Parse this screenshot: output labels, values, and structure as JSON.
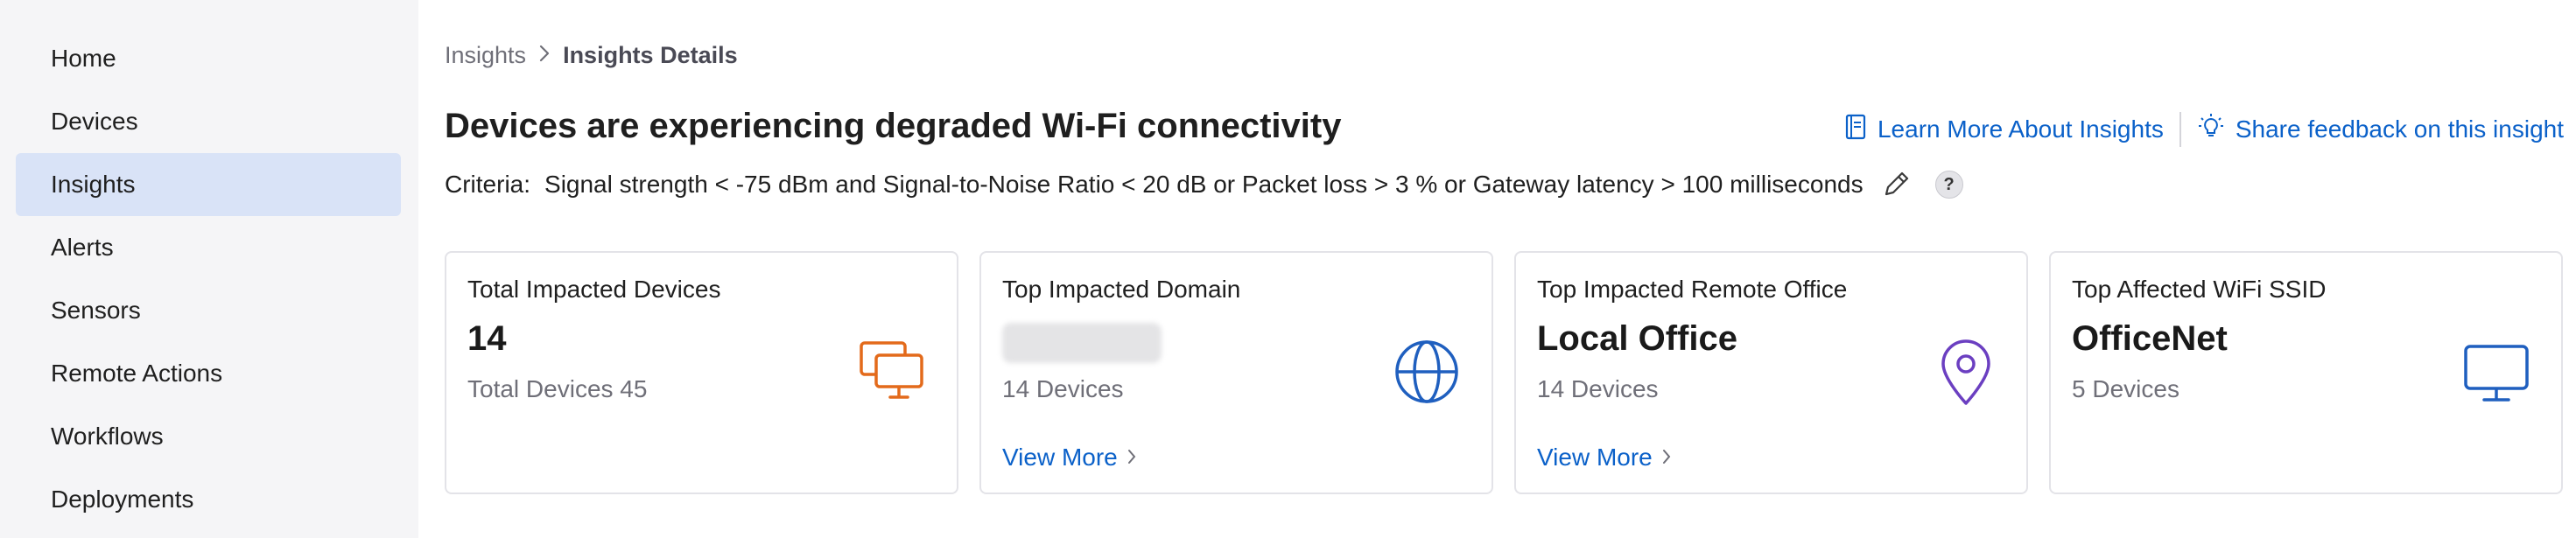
{
  "sidebar": {
    "items": [
      {
        "label": "Home"
      },
      {
        "label": "Devices"
      },
      {
        "label": "Insights",
        "active": true
      },
      {
        "label": "Alerts"
      },
      {
        "label": "Sensors"
      },
      {
        "label": "Remote Actions"
      },
      {
        "label": "Workflows"
      },
      {
        "label": "Deployments"
      }
    ]
  },
  "breadcrumb": {
    "parent": "Insights",
    "separator": ">",
    "current": "Insights Details"
  },
  "page": {
    "title": "Devices are experiencing degraded Wi-Fi connectivity"
  },
  "header_links": {
    "learn_more": "Learn More About Insights",
    "feedback": "Share feedback on this insight"
  },
  "criteria": {
    "label": "Criteria:",
    "text": "Signal strength < -75 dBm and Signal-to-Noise Ratio < 20 dB or Packet loss > 3 % or Gateway latency > 100 milliseconds",
    "help": "?"
  },
  "cards": {
    "total": {
      "title": "Total Impacted Devices",
      "value": "14",
      "sub": "Total Devices 45",
      "icon": "devices-icon",
      "color": "#e36a1b"
    },
    "domain": {
      "title": "Top Impacted Domain",
      "sub": "14 Devices",
      "link": "View More",
      "icon": "globe-icon",
      "color": "#1f5fbf"
    },
    "office": {
      "title": "Top Impacted Remote Office",
      "value": "Local Office",
      "sub": "14 Devices",
      "link": "View More",
      "icon": "location-pin-icon",
      "color": "#6b3fc1"
    },
    "ssid": {
      "title": "Top Affected WiFi SSID",
      "value": "OfficeNet",
      "sub": "5 Devices",
      "icon": "monitor-icon",
      "color": "#1f5fbf"
    }
  }
}
